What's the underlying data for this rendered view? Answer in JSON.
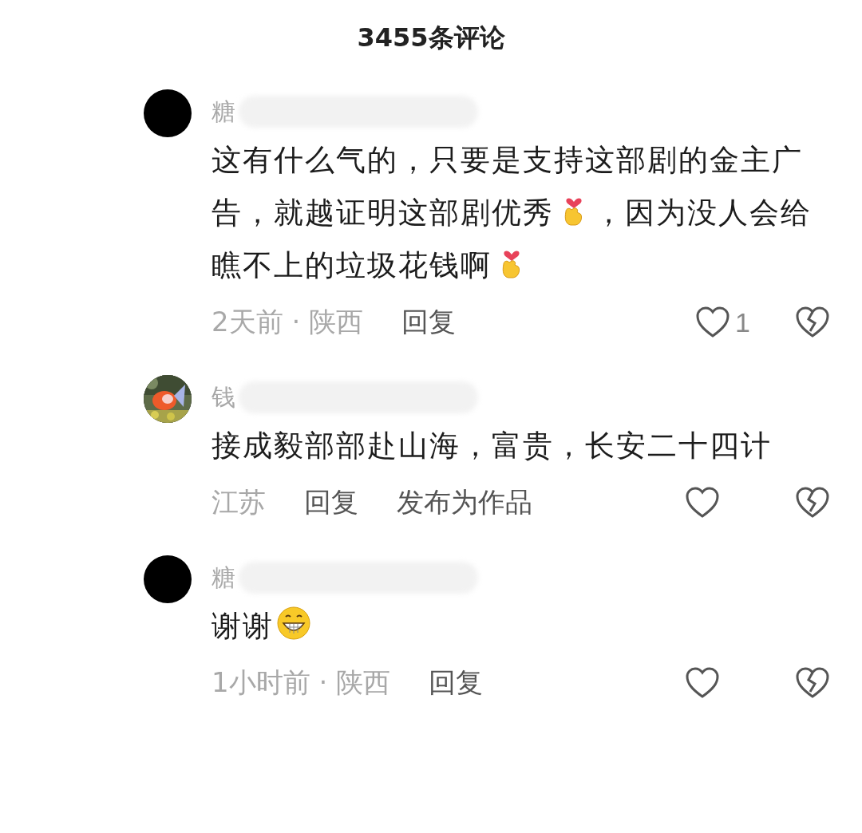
{
  "header": {
    "title": "3455条评论"
  },
  "comments": [
    {
      "name": "糖",
      "avatar": {
        "kind": "plain"
      },
      "body": [
        {
          "kind": "text",
          "text": "这有什么气的，只要是支持这部剧的金主广告，就越证明这部剧优秀"
        },
        {
          "kind": "finger-heart"
        },
        {
          "kind": "text",
          "text": "，因为没人会给瞧不上的垃圾花钱啊"
        },
        {
          "kind": "finger-heart"
        }
      ],
      "meta": "2天前 · 陕西",
      "actions": [
        "回复"
      ],
      "liked": false,
      "like_count": "1"
    },
    {
      "name": "钱",
      "avatar": {
        "kind": "picture"
      },
      "body": [
        {
          "kind": "text",
          "text": "接成毅部部赴山海，富贵，长安二十四计"
        }
      ],
      "meta": "江苏",
      "actions": [
        "回复",
        "发布为作品"
      ],
      "liked": false
    },
    {
      "name": "糖",
      "avatar": {
        "kind": "plain"
      },
      "body": [
        {
          "kind": "text",
          "text": "谢谢"
        },
        {
          "kind": "grin"
        }
      ],
      "meta": "1小时前 · 陕西",
      "actions": [
        "回复"
      ],
      "liked": false
    }
  ]
}
